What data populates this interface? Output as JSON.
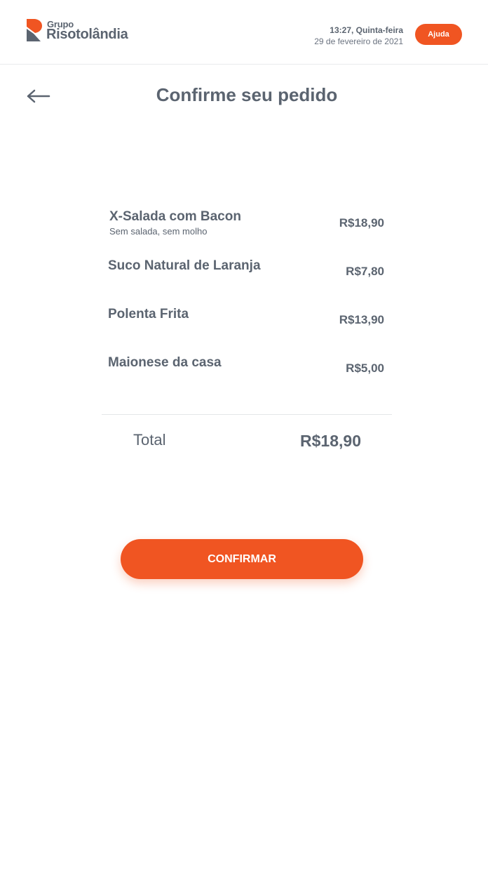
{
  "brand": {
    "small": "Grupo",
    "big": "Risotolândia",
    "accent_color": "#f05522",
    "logo_icon": "risotolandia-logo-icon"
  },
  "header": {
    "time": "13:27, Quinta-feira",
    "date": "29 de fevereiro de 2021",
    "help_label": "Ajuda"
  },
  "page": {
    "title": "Confirme seu pedido",
    "back_icon": "arrow-left-icon"
  },
  "order": {
    "items": [
      {
        "name": "X-Salada com Bacon",
        "note": "Sem salada, sem molho",
        "price": "R$18,90"
      },
      {
        "name": "Suco Natural de Laranja",
        "price": "R$7,80"
      },
      {
        "name": "Polenta Frita",
        "price": "R$13,90"
      },
      {
        "name": "Maionese da casa",
        "price": "R$5,00"
      }
    ],
    "total_label": "Total",
    "total_value": "R$18,90"
  },
  "actions": {
    "confirm_label": "CONFIRMAR"
  }
}
